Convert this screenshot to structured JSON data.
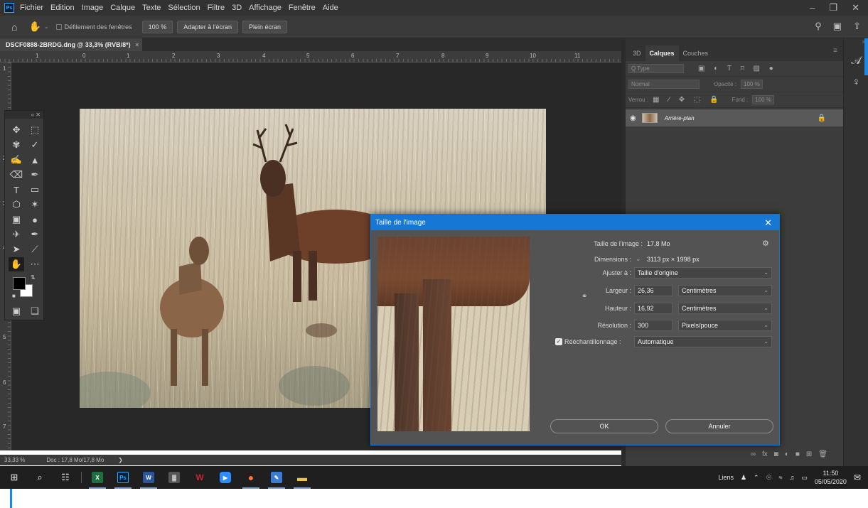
{
  "app": {
    "name": "Photoshop",
    "logo": "Ps",
    "accent": "#31a8ff"
  },
  "menu": [
    "Fichier",
    "Edition",
    "Image",
    "Calque",
    "Texte",
    "Sélection",
    "Filtre",
    "3D",
    "Affichage",
    "Fenêtre",
    "Aide"
  ],
  "window_controls": {
    "minimize": "–",
    "restore": "❐",
    "close": "✕"
  },
  "options_bar": {
    "scroll_all_label": "Défilement des fenêtres",
    "zoom_100": "100 %",
    "fit_screen": "Adapter à l'écran",
    "fill_screen": "Plein écran"
  },
  "document": {
    "tab_title": "DSCF0888-2BRDG.dng @ 33,3% (RVB/8*)",
    "zoom_status": "33,33 %",
    "doc_size_status": "Doc : 17,8 Mo/17,8 Mo",
    "status_arrow": "❯"
  },
  "rulers": {
    "horizontal": [
      "1",
      "0",
      "1",
      "2",
      "3",
      "4",
      "5",
      "6",
      "7",
      "8",
      "9",
      "10",
      "11"
    ],
    "vertical": [
      "1",
      "2",
      "3",
      "4",
      "5",
      "6",
      "7"
    ]
  },
  "layers_panel": {
    "tabs": [
      "3D",
      "Calques",
      "Couches"
    ],
    "active_tab": "Calques",
    "menu_icon": "≡",
    "filter_label": "Q Type",
    "filter_icons": "▣ ◐ T ⌑ ▨ ●",
    "blend_mode": "Normal",
    "opacity_label": "Opacité :",
    "opacity_value": "100 %",
    "lock_label": "Verrou :",
    "lock_icons": "▦ ∕ ✥ ⬚ 🔒",
    "fill_label": "Fond :",
    "fill_value": "100 %",
    "layer_visibility_icon": "eye-icon",
    "layer_name": "Arrière-plan",
    "layer_lock": "🔒",
    "footer_icons": [
      "∞",
      "fx",
      "◙",
      "◐",
      "■",
      "⊞",
      "🗑"
    ]
  },
  "dock_icons": [
    "𝒜",
    "♀"
  ],
  "dialog": {
    "title": "Taille de l'image",
    "close": "✕",
    "size_label": "Taille de l'image :",
    "size_value": "17,8 Mo",
    "settings_icon": "⚙",
    "dimensions_label": "Dimensions :",
    "dimensions_value": "3113 px  ×  1998 px",
    "fit_label": "Ajuster à :",
    "fit_value": "Taille d'origine",
    "width_label": "Largeur :",
    "width_value": "26,36",
    "width_unit": "Centimètres",
    "height_label": "Hauteur :",
    "height_value": "16,92",
    "height_unit": "Centimètres",
    "resolution_label": "Résolution :",
    "resolution_value": "300",
    "resolution_unit": "Pixels/pouce",
    "resample_label": "Rééchantillonnage :",
    "resample_checked": true,
    "resample_value": "Automatique",
    "ok": "OK",
    "cancel": "Annuler"
  },
  "taskbar": {
    "links_label": "Liens",
    "time": "11:50",
    "date": "05/05/2020",
    "apps": [
      {
        "name": "windows-start",
        "glyph": "⊞"
      },
      {
        "name": "search",
        "glyph": "⌕"
      },
      {
        "name": "task-view",
        "glyph": "☷"
      },
      {
        "name": "excel",
        "glyph": "X",
        "color": "#1d6f42"
      },
      {
        "name": "photoshop",
        "glyph": "Ps",
        "color": "#001e36"
      },
      {
        "name": "word",
        "glyph": "W",
        "color": "#2b579a"
      },
      {
        "name": "calculator",
        "glyph": "▓",
        "color": "#555555"
      },
      {
        "name": "wps",
        "glyph": "W",
        "color": "#c4262e"
      },
      {
        "name": "zoom",
        "glyph": "▶",
        "color": "#2d8cff"
      },
      {
        "name": "firefox",
        "glyph": "●",
        "color": "#ff7139"
      },
      {
        "name": "paint",
        "glyph": "✎",
        "color": "#3a7bd5"
      },
      {
        "name": "file-explorer",
        "glyph": "▬",
        "color": "#f2c14e"
      }
    ]
  }
}
